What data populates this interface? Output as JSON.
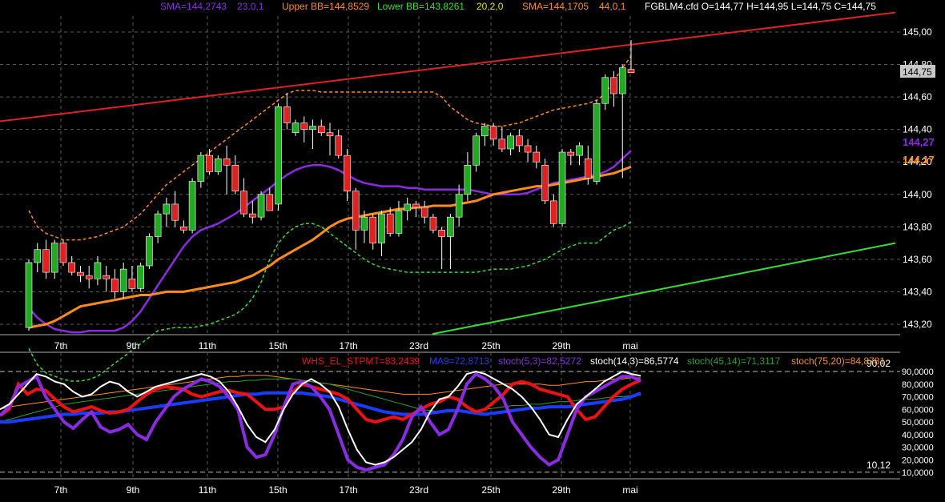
{
  "colors": {
    "background": "#000000",
    "grid": "#5a5a5a",
    "up": "#22aa22",
    "down": "#dd2222",
    "sma23": "#8a2be2",
    "sma44": "#ff8c1a",
    "bb_upper": "#ff8c1a",
    "bb_lower": "#33dd33",
    "trend_upper": "#dd2222",
    "trend_lower": "#33dd33",
    "whs": "#ee1111",
    "ma9": "#1a3cff",
    "stoch53": "#8a2be2",
    "stoch143": "#ffffff",
    "stoch4514": "#2aa02a",
    "stoch7520": "#ff8c1a"
  },
  "price_legend": {
    "sma_label": "SMA=144,2743",
    "sma_params": "23,0,1",
    "upper_bb": "Upper BB=144,8529",
    "lower_bb": "Lower BB=143,8261",
    "bb_params": "20,2,0",
    "sma2_label": "SMA=144,1705",
    "sma2_params": "44,0,1",
    "ohlc": "FGBLM4.cfd O=144,77 H=144,95 L=144,75 C=144,75"
  },
  "indicator_legend": {
    "whs": "WHS_EL_STPMT=83,2439",
    "ma9": "MA9=72,8713",
    "stoch53": "stoch(5,3)=82,5272",
    "stoch143": "stoch(14,3)=86,5774",
    "stoch4514": "stoch(45,14)=71,3117",
    "stoch7520": "stoch(75,20)=84,8781"
  },
  "price_axis_labels": [
    "145,00",
    "144,80",
    "144,60",
    "144,40",
    "144,20",
    "144,00",
    "143,80",
    "143,60",
    "143,40",
    "143,20"
  ],
  "current_price_tag": "144,75",
  "sma23_tag": "144,27",
  "sma44_tag": "144,17",
  "indicator_axis_labels": [
    "90,0000",
    "80,0000",
    "70,0000",
    "60,0000",
    "50,0000",
    "40,0000",
    "30,0000",
    "20,0000",
    "10,0000"
  ],
  "level_high_label": "90,02",
  "level_low_label": "10,12",
  "date_labels": [
    "7th",
    "9th",
    "11th",
    "15th",
    "17th",
    "23rd",
    "25th",
    "29th",
    "mai"
  ],
  "chart_data": {
    "type": "candlestick",
    "symbol": "FGBLM4.cfd",
    "ylim": [
      143.14,
      145.12
    ],
    "candles": [
      [
        143.18,
        143.6,
        143.16,
        143.58
      ],
      [
        143.58,
        143.7,
        143.52,
        143.66
      ],
      [
        143.66,
        143.72,
        143.48,
        143.52
      ],
      [
        143.52,
        143.72,
        143.48,
        143.7
      ],
      [
        143.7,
        143.72,
        143.56,
        143.58
      ],
      [
        143.58,
        143.62,
        143.5,
        143.52
      ],
      [
        143.52,
        143.56,
        143.46,
        143.5
      ],
      [
        143.5,
        143.56,
        143.42,
        143.48
      ],
      [
        143.48,
        143.62,
        143.44,
        143.58
      ],
      [
        143.5,
        143.56,
        143.4,
        143.48
      ],
      [
        143.48,
        143.54,
        143.36,
        143.4
      ],
      [
        143.4,
        143.58,
        143.36,
        143.54
      ],
      [
        143.48,
        143.56,
        143.4,
        143.42
      ],
      [
        143.42,
        143.58,
        143.4,
        143.56
      ],
      [
        143.56,
        143.76,
        143.54,
        143.74
      ],
      [
        143.74,
        143.9,
        143.7,
        143.88
      ],
      [
        143.88,
        143.98,
        143.8,
        143.94
      ],
      [
        143.94,
        144.02,
        143.8,
        143.84
      ],
      [
        143.8,
        143.84,
        143.76,
        143.78
      ],
      [
        143.78,
        144.1,
        143.76,
        144.08
      ],
      [
        144.08,
        144.26,
        144.04,
        144.24
      ],
      [
        144.24,
        144.28,
        144.12,
        144.14
      ],
      [
        144.14,
        144.24,
        144.12,
        144.22
      ],
      [
        144.22,
        144.3,
        144.0,
        144.18
      ],
      [
        144.18,
        144.24,
        144.0,
        144.02
      ],
      [
        144.02,
        144.1,
        143.86,
        143.88
      ],
      [
        143.88,
        143.96,
        143.82,
        143.86
      ],
      [
        143.86,
        144.02,
        143.84,
        144.0
      ],
      [
        144.0,
        144.04,
        143.9,
        143.9
      ],
      [
        143.94,
        144.56,
        143.9,
        144.54
      ],
      [
        144.54,
        144.62,
        144.4,
        144.44
      ],
      [
        144.38,
        144.46,
        144.36,
        144.44
      ],
      [
        144.44,
        144.48,
        144.32,
        144.4
      ],
      [
        144.4,
        144.46,
        144.28,
        144.42
      ],
      [
        144.42,
        144.46,
        144.36,
        144.38
      ],
      [
        144.38,
        144.44,
        144.24,
        144.36
      ],
      [
        144.36,
        144.4,
        144.22,
        144.24
      ],
      [
        144.24,
        144.28,
        143.96,
        144.02
      ],
      [
        144.02,
        144.04,
        143.66,
        143.78
      ],
      [
        143.78,
        143.9,
        143.7,
        143.86
      ],
      [
        143.86,
        143.88,
        143.66,
        143.7
      ],
      [
        143.7,
        143.9,
        143.62,
        143.88
      ],
      [
        143.88,
        143.92,
        143.74,
        143.76
      ],
      [
        143.76,
        143.96,
        143.74,
        143.9
      ],
      [
        143.9,
        143.98,
        143.84,
        143.94
      ],
      [
        143.94,
        143.96,
        143.86,
        143.92
      ],
      [
        143.92,
        143.96,
        143.82,
        143.86
      ],
      [
        143.86,
        143.88,
        143.76,
        143.78
      ],
      [
        143.78,
        143.8,
        143.54,
        143.74
      ],
      [
        143.74,
        143.88,
        143.54,
        143.86
      ],
      [
        143.86,
        144.06,
        143.8,
        144.0
      ],
      [
        144.0,
        144.26,
        143.96,
        144.18
      ],
      [
        144.18,
        144.38,
        144.14,
        144.36
      ],
      [
        144.36,
        144.44,
        144.3,
        144.42
      ],
      [
        144.42,
        144.44,
        144.3,
        144.34
      ],
      [
        144.34,
        144.42,
        144.26,
        144.28
      ],
      [
        144.28,
        144.38,
        144.24,
        144.36
      ],
      [
        144.36,
        144.4,
        144.26,
        144.3
      ],
      [
        144.3,
        144.34,
        144.2,
        144.26
      ],
      [
        144.26,
        144.3,
        144.16,
        144.2
      ],
      [
        144.18,
        144.22,
        143.94,
        143.96
      ],
      [
        143.96,
        144.0,
        143.8,
        143.82
      ],
      [
        143.82,
        144.28,
        143.8,
        144.26
      ],
      [
        144.26,
        144.28,
        144.18,
        144.24
      ],
      [
        144.24,
        144.32,
        144.18,
        144.3
      ],
      [
        144.22,
        144.3,
        144.06,
        144.1
      ],
      [
        144.08,
        144.58,
        144.06,
        144.56
      ],
      [
        144.56,
        144.74,
        144.52,
        144.72
      ],
      [
        144.72,
        144.76,
        144.54,
        144.62
      ],
      [
        144.62,
        144.8,
        144.1,
        144.78
      ],
      [
        144.77,
        144.95,
        144.75,
        144.75
      ]
    ],
    "sma23": [
      143.3,
      143.24,
      143.2,
      143.17,
      143.16,
      143.15,
      143.15,
      143.16,
      143.16,
      143.16,
      143.16,
      143.18,
      143.22,
      143.28,
      143.36,
      143.44,
      143.52,
      143.6,
      143.68,
      143.74,
      143.78,
      143.8,
      143.82,
      143.85,
      143.88,
      143.92,
      143.96,
      144.0,
      144.04,
      144.08,
      144.12,
      144.15,
      144.17,
      144.18,
      144.18,
      144.17,
      144.15,
      144.12,
      144.09,
      144.07,
      144.06,
      144.05,
      144.05,
      144.05,
      144.04,
      144.04,
      144.03,
      144.03,
      144.03,
      144.03,
      144.03,
      144.03,
      144.02,
      144.01,
      144.0,
      144.0,
      144.0,
      144.0,
      144.01,
      144.03,
      144.05,
      144.07,
      144.08,
      144.09,
      144.1,
      144.11,
      144.12,
      144.14,
      144.17,
      144.22,
      144.27
    ],
    "sma44": [
      143.18,
      143.19,
      143.2,
      143.22,
      143.25,
      143.28,
      143.31,
      143.32,
      143.33,
      143.34,
      143.35,
      143.36,
      143.37,
      143.38,
      143.38,
      143.39,
      143.4,
      143.4,
      143.4,
      143.41,
      143.42,
      143.43,
      143.44,
      143.45,
      143.46,
      143.48,
      143.5,
      143.53,
      143.56,
      143.6,
      143.63,
      143.66,
      143.69,
      143.72,
      143.76,
      143.8,
      143.83,
      143.85,
      143.86,
      143.87,
      143.88,
      143.89,
      143.9,
      143.91,
      143.91,
      143.92,
      143.92,
      143.93,
      143.93,
      143.93,
      143.94,
      143.95,
      143.96,
      143.98,
      144.0,
      144.01,
      144.02,
      144.03,
      144.04,
      144.05,
      144.05,
      144.06,
      144.07,
      144.08,
      144.09,
      144.1,
      144.11,
      144.12,
      144.13,
      144.15,
      144.17
    ],
    "bb_upper": [
      143.9,
      143.8,
      143.76,
      143.74,
      143.72,
      143.72,
      143.72,
      143.73,
      143.74,
      143.76,
      143.78,
      143.8,
      143.84,
      143.88,
      143.94,
      144.0,
      144.06,
      144.1,
      144.14,
      144.18,
      144.22,
      144.26,
      144.3,
      144.34,
      144.38,
      144.42,
      144.46,
      144.5,
      144.54,
      144.58,
      144.62,
      144.64,
      144.64,
      144.64,
      144.63,
      144.63,
      144.63,
      144.63,
      144.63,
      144.63,
      144.63,
      144.63,
      144.63,
      144.63,
      144.63,
      144.63,
      144.63,
      144.63,
      144.6,
      144.54,
      144.5,
      144.46,
      144.44,
      144.43,
      144.42,
      144.42,
      144.43,
      144.44,
      144.46,
      144.48,
      144.5,
      144.52,
      144.53,
      144.54,
      144.55,
      144.56,
      144.58,
      144.62,
      144.7,
      144.78,
      144.85
    ],
    "bb_lower": [
      143.05,
      142.95,
      142.9,
      142.88,
      142.86,
      142.85,
      142.85,
      142.86,
      142.88,
      142.92,
      142.96,
      143.0,
      143.04,
      143.08,
      143.12,
      143.16,
      143.17,
      143.18,
      143.18,
      143.18,
      143.19,
      143.2,
      143.22,
      143.24,
      143.26,
      143.3,
      143.36,
      143.46,
      143.6,
      143.7,
      143.76,
      143.8,
      143.82,
      143.82,
      143.8,
      143.76,
      143.72,
      143.68,
      143.64,
      143.6,
      143.57,
      143.55,
      143.54,
      143.53,
      143.52,
      143.52,
      143.52,
      143.52,
      143.52,
      143.52,
      143.52,
      143.52,
      143.52,
      143.53,
      143.54,
      143.54,
      143.54,
      143.55,
      143.56,
      143.58,
      143.6,
      143.63,
      143.66,
      143.68,
      143.7,
      143.7,
      143.7,
      143.74,
      143.78,
      143.8,
      143.83
    ],
    "trend_upper": [
      [
        0,
        144.45
      ],
      [
        1118,
        145.12
      ]
    ],
    "trend_lower": [
      [
        540,
        143.14
      ],
      [
        1118,
        143.7
      ]
    ],
    "indicators": {
      "ylim": [
        5,
        95
      ],
      "levels": [
        90.02,
        10.12
      ],
      "whs": [
        55,
        60,
        80,
        72,
        76,
        75,
        68,
        62,
        58,
        60,
        62,
        59,
        57,
        58,
        60,
        66,
        72,
        76,
        78,
        77,
        76,
        72,
        70,
        72,
        74,
        75,
        73,
        72,
        66,
        60,
        60,
        62,
        74,
        80,
        78,
        76,
        74,
        72,
        68,
        60,
        52,
        50,
        52,
        54,
        52,
        56,
        60,
        64,
        66,
        70,
        68,
        62,
        58,
        60,
        66,
        72,
        80,
        82,
        80,
        76,
        74,
        72,
        70,
        60,
        52,
        54,
        62,
        70,
        76,
        80,
        83
      ],
      "ma9": [
        50,
        50,
        51,
        52,
        53,
        54,
        55,
        56,
        56,
        57,
        57,
        57,
        58,
        58,
        59,
        60,
        61,
        62,
        63,
        64,
        65,
        66,
        67,
        68,
        69,
        70,
        71,
        72,
        72,
        73,
        73,
        73,
        73,
        73,
        72,
        71,
        70,
        68,
        66,
        64,
        62,
        60,
        58,
        57,
        56,
        56,
        56,
        57,
        58,
        59,
        59,
        58,
        57,
        56,
        57,
        58,
        59,
        60,
        61,
        61,
        62,
        62,
        62,
        63,
        64,
        65,
        66,
        67,
        68,
        70,
        72.87
      ],
      "stoch53": [
        55,
        62,
        78,
        82,
        86,
        70,
        60,
        50,
        45,
        52,
        58,
        46,
        42,
        44,
        48,
        40,
        36,
        50,
        60,
        70,
        76,
        80,
        84,
        82,
        78,
        70,
        60,
        30,
        22,
        24,
        40,
        62,
        80,
        82,
        78,
        70,
        60,
        40,
        20,
        14,
        12,
        14,
        16,
        24,
        36,
        54,
        62,
        50,
        40,
        44,
        60,
        80,
        88,
        84,
        78,
        68,
        50,
        40,
        30,
        22,
        16,
        20,
        40,
        60,
        70,
        74,
        78,
        82,
        86,
        86,
        82.5
      ],
      "stoch143": [
        60,
        64,
        72,
        80,
        88,
        86,
        82,
        80,
        74,
        70,
        72,
        78,
        82,
        80,
        74,
        70,
        74,
        78,
        80,
        82,
        84,
        86,
        88,
        86,
        82,
        74,
        62,
        48,
        38,
        34,
        44,
        60,
        72,
        80,
        84,
        80,
        74,
        62,
        44,
        28,
        18,
        16,
        18,
        22,
        28,
        34,
        44,
        58,
        68,
        70,
        78,
        88,
        90,
        88,
        84,
        80,
        76,
        70,
        62,
        52,
        40,
        38,
        52,
        64,
        70,
        76,
        82,
        86,
        90,
        88,
        86.6
      ],
      "stoch4514": [
        50,
        52,
        54,
        56,
        58,
        60,
        62,
        64,
        65,
        66,
        67,
        68,
        69,
        70,
        71,
        72,
        73,
        74,
        75,
        76,
        77,
        78,
        79,
        80,
        81,
        82,
        82,
        83,
        83,
        84,
        84,
        84,
        84,
        83,
        82,
        81,
        80,
        78,
        76,
        74,
        72,
        70,
        68,
        66,
        64,
        62,
        60,
        59,
        58,
        58,
        58,
        58,
        59,
        60,
        61,
        62,
        63,
        63,
        64,
        64,
        65,
        66,
        66,
        67,
        68,
        68,
        69,
        70,
        70,
        71,
        71.3
      ],
      "stoch7520": [
        60,
        62,
        63,
        64,
        65,
        66,
        67,
        68,
        69,
        70,
        71,
        72,
        73,
        74,
        75,
        76,
        77,
        78,
        79,
        80,
        81,
        82,
        83,
        84,
        85,
        86,
        86,
        87,
        87,
        87,
        86,
        85,
        84,
        83,
        82,
        81,
        80,
        79,
        78,
        77,
        76,
        75,
        74,
        73,
        72,
        72,
        72,
        72,
        73,
        74,
        75,
        76,
        77,
        78,
        79,
        80,
        80,
        80,
        80,
        80,
        79,
        79,
        80,
        81,
        82,
        82,
        83,
        84,
        84,
        85,
        84.9
      ]
    }
  }
}
